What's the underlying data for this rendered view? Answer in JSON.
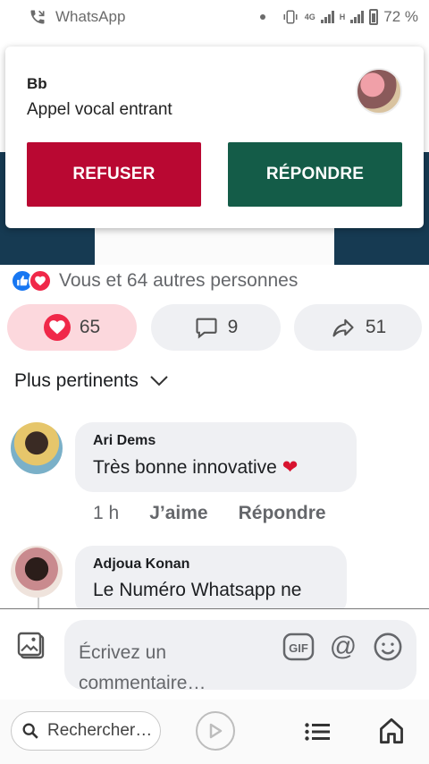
{
  "status_bar": {
    "app_name": "WhatsApp",
    "network_4g": "4G",
    "network_h": "H",
    "battery": "72 %"
  },
  "call": {
    "caller": "Bb",
    "type": "Appel vocal entrant",
    "decline_label": "REFUSER",
    "answer_label": "RÉPONDRE"
  },
  "post": {
    "reactions_text": "Vous et 64 autres personnes",
    "love_count": "65",
    "comment_count": "9",
    "share_count": "51"
  },
  "sort": {
    "label": "Plus pertinents"
  },
  "comments": [
    {
      "author": "Ari Dems",
      "text": "Très bonne innovative",
      "emoji": "❤",
      "time": "1 h",
      "like_label": "J’aime",
      "reply_label": "Répondre"
    },
    {
      "author": "Adjoua Konan",
      "text": "Le Numéro Whatsapp ne"
    }
  ],
  "composer": {
    "placeholder": "Écrivez un commentaire…",
    "gif_label": "GIF",
    "at_label": "@"
  },
  "bottom_bar": {
    "search_label": "Rechercher…"
  },
  "colors": {
    "decline": "#b90832",
    "answer": "#145c48",
    "like_blue": "#1877f2",
    "love_red": "#f02849",
    "pill_love_bg": "#fcd8dd"
  }
}
